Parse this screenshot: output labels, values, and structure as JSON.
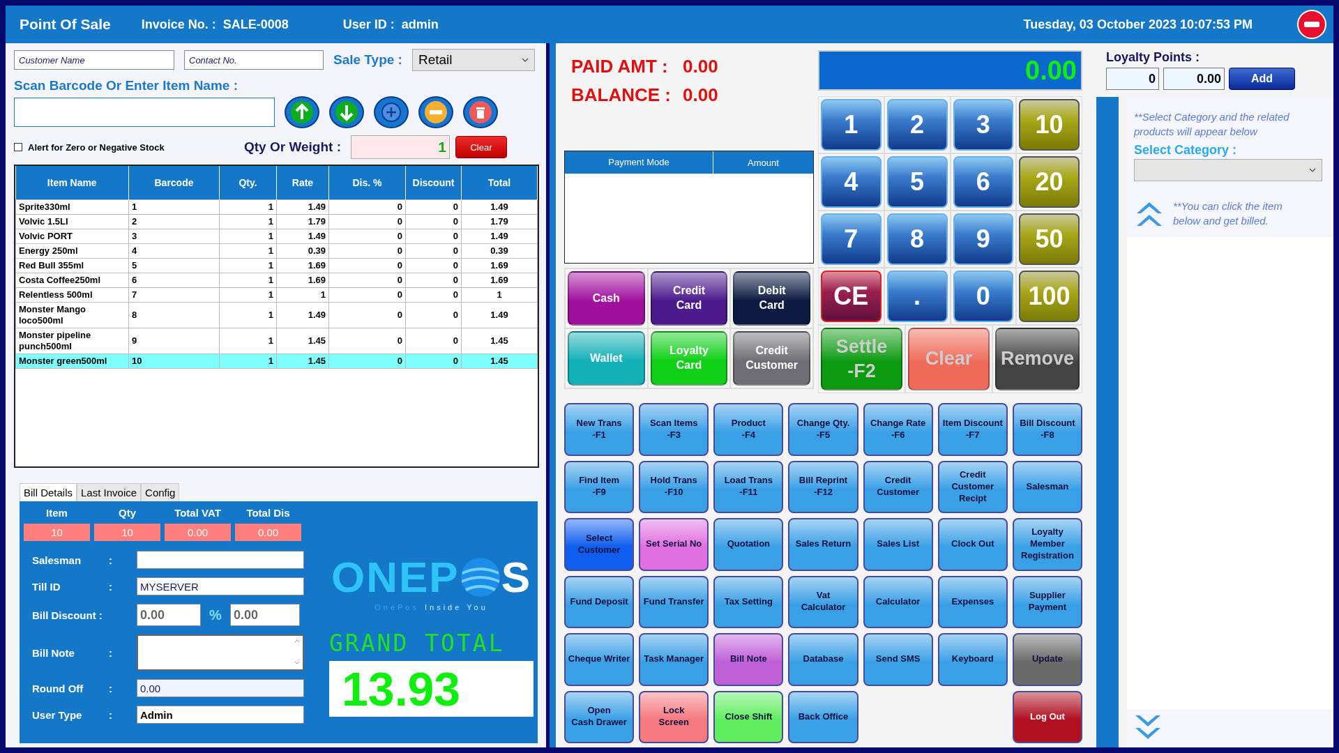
{
  "header": {
    "title": "Point Of Sale",
    "invoice_label": "Invoice No. :",
    "invoice_no": "SALE-0008",
    "user_label": "User ID :",
    "user_id": "admin",
    "datetime": "Tuesday, 03 October 2023 10:07:53 PM"
  },
  "customer": {
    "name_placeholder": "Customer Name",
    "contact_placeholder": "Contact No.",
    "sale_type_label": "Sale Type :",
    "sale_type": "Retail"
  },
  "scan": {
    "label": "Scan Barcode Or Enter Item Name :"
  },
  "stock_alert": {
    "label": "Alert for Zero or Negative Stock",
    "checked": false
  },
  "qty": {
    "label": "Qty Or Weight :",
    "value": "1",
    "clear": "Clear"
  },
  "table": {
    "columns": [
      "Item Name",
      "Barcode",
      "Qty.",
      "Rate",
      "Dis. %",
      "Discount",
      "Total"
    ],
    "rows": [
      {
        "cells": [
          "Sprite330ml",
          "1",
          "1",
          "1.49",
          "0",
          "0",
          "1.49"
        ],
        "selected": false
      },
      {
        "cells": [
          "Volvic 1.5LI",
          "2",
          "1",
          "1.79",
          "0",
          "0",
          "1.79"
        ],
        "selected": false
      },
      {
        "cells": [
          "Volvic PORT",
          "3",
          "1",
          "1.49",
          "0",
          "0",
          "1.49"
        ],
        "selected": false
      },
      {
        "cells": [
          "Energy 250ml",
          "4",
          "1",
          "0.39",
          "0",
          "0",
          "0.39"
        ],
        "selected": false
      },
      {
        "cells": [
          "Red Bull 355ml",
          "5",
          "1",
          "1.69",
          "0",
          "0",
          "1.69"
        ],
        "selected": false
      },
      {
        "cells": [
          "Costa Coffee250ml",
          "6",
          "1",
          "1.69",
          "0",
          "0",
          "1.69"
        ],
        "selected": false
      },
      {
        "cells": [
          "Relentless 500ml",
          "7",
          "1",
          "1",
          "0",
          "0",
          "1"
        ],
        "selected": false
      },
      {
        "cells": [
          "Monster Mango loco500ml",
          "8",
          "1",
          "1.49",
          "0",
          "0",
          "1.49"
        ],
        "selected": false
      },
      {
        "cells": [
          "Monster pipeline punch500ml",
          "9",
          "1",
          "1.45",
          "0",
          "0",
          "1.45"
        ],
        "selected": false
      },
      {
        "cells": [
          "Monster green500ml",
          "10",
          "1",
          "1.45",
          "0",
          "0",
          "1.45"
        ],
        "selected": true
      }
    ]
  },
  "tabs": [
    {
      "label": "Bill Details",
      "selected": true
    },
    {
      "label": "Last Invoice",
      "selected": false
    },
    {
      "label": "Config",
      "selected": false
    }
  ],
  "summary": [
    {
      "label": "Item",
      "value": "10"
    },
    {
      "label": "Qty",
      "value": "10"
    },
    {
      "label": "Total VAT",
      "value": "0.00"
    },
    {
      "label": "Total Dis",
      "value": "0.00"
    }
  ],
  "bill": {
    "salesman_label": "Salesman",
    "till_label": "Till ID",
    "till": "MYSERVER",
    "discount_label": "Bill Discount :",
    "discount": "0.00",
    "percent_sign": "%",
    "discount_pct": "0.00",
    "note_label": "Bill Note",
    "round_label": "Round Off",
    "round_off": "0.00",
    "user_type_label": "User Type",
    "user_type": "Admin",
    "colon": ":"
  },
  "logo": {
    "left": "ONEP",
    "right": "S",
    "tagline_brand": "OnePos",
    "tagline_rest": "Inside You"
  },
  "grand_total": {
    "label": "GRAND TOTAL",
    "value": "13.93"
  },
  "payment": {
    "paid_label": "PAID AMT :",
    "paid": "0.00",
    "balance_label": "BALANCE :",
    "balance": "0.00",
    "display": "0.00",
    "columns": [
      "Payment Mode",
      "Amount"
    ]
  },
  "keypad": [
    {
      "label": "1",
      "kind": "digit"
    },
    {
      "label": "2",
      "kind": "digit"
    },
    {
      "label": "3",
      "kind": "digit"
    },
    {
      "label": "10",
      "kind": "amount"
    },
    {
      "label": "4",
      "kind": "digit"
    },
    {
      "label": "5",
      "kind": "digit"
    },
    {
      "label": "6",
      "kind": "digit"
    },
    {
      "label": "20",
      "kind": "amount"
    },
    {
      "label": "7",
      "kind": "digit"
    },
    {
      "label": "8",
      "kind": "digit"
    },
    {
      "label": "9",
      "kind": "digit"
    },
    {
      "label": "50",
      "kind": "amount"
    },
    {
      "label": "CE",
      "kind": "cancel"
    },
    {
      "label": ".",
      "kind": "digit"
    },
    {
      "label": "0",
      "kind": "digit"
    },
    {
      "label": "100",
      "kind": "amount"
    }
  ],
  "payment_modes": [
    {
      "label": "Cash",
      "color": "#a0109e"
    },
    {
      "label": "Credit\nCard",
      "color": "#4b1a8c"
    },
    {
      "label": "Debit\nCard",
      "color": "#0a1a40"
    },
    {
      "label": "Wallet",
      "color": "#14b0b8"
    },
    {
      "label": "Loyalty\nCard",
      "color": "#10d018"
    },
    {
      "label": "Credit\nCustomer",
      "color": "#6e6e74"
    }
  ],
  "actions": [
    {
      "label": "Settle\n-F2",
      "color": "#0c9a10"
    },
    {
      "label": "Clear",
      "color": "#ef6a58"
    },
    {
      "label": "Remove",
      "color": "#444444"
    }
  ],
  "function_buttons": [
    {
      "label": "New Trans\n-F1",
      "color": "#3aa0e6"
    },
    {
      "label": "Scan Items\n-F3",
      "color": "#3aa0e6"
    },
    {
      "label": "Product\n-F4",
      "color": "#3aa0e6"
    },
    {
      "label": "Change Qty.\n-F5",
      "color": "#3aa0e6"
    },
    {
      "label": "Change Rate\n-F6",
      "color": "#3aa0e6"
    },
    {
      "label": "Item Discount\n-F7",
      "color": "#3aa0e6"
    },
    {
      "label": "Bill Discount\n-F8",
      "color": "#3aa0e6"
    },
    {
      "label": "Find Item\n-F9",
      "color": "#3aa0e6"
    },
    {
      "label": "Hold Trans\n-F10",
      "color": "#3aa0e6"
    },
    {
      "label": "Load Trans\n-F11",
      "color": "#3aa0e6"
    },
    {
      "label": "Bill Reprint\n-F12",
      "color": "#3aa0e6"
    },
    {
      "label": "Credit\nCustomer",
      "color": "#3aa0e6"
    },
    {
      "label": "Credit\nCustomer\nRecipt",
      "color": "#3aa0e6"
    },
    {
      "label": "Salesman",
      "color": "#3aa0e6"
    },
    {
      "label": "Select Customer",
      "color": "#0f5ef0"
    },
    {
      "label": "Set Serial No",
      "color": "#e070e0"
    },
    {
      "label": "Quotation",
      "color": "#3aa0e6"
    },
    {
      "label": "Sales Return",
      "color": "#3aa0e6"
    },
    {
      "label": "Sales List",
      "color": "#3aa0e6"
    },
    {
      "label": "Clock Out",
      "color": "#3aa0e6"
    },
    {
      "label": "Loyalty Member Registration",
      "color": "#3aa0e6"
    },
    {
      "label": "Fund Deposit",
      "color": "#3aa0e6"
    },
    {
      "label": "Fund Transfer",
      "color": "#3aa0e6"
    },
    {
      "label": "Tax Setting",
      "color": "#3aa0e6"
    },
    {
      "label": "Vat\nCalculator",
      "color": "#3aa0e6"
    },
    {
      "label": "Calculator",
      "color": "#3aa0e6"
    },
    {
      "label": "Expenses",
      "color": "#3aa0e6"
    },
    {
      "label": "Supplier Payment",
      "color": "#3aa0e6"
    },
    {
      "label": "Cheque Writer",
      "color": "#3aa0e6"
    },
    {
      "label": "Task Manager",
      "color": "#3aa0e6"
    },
    {
      "label": "Bill Note",
      "color": "#c060d8"
    },
    {
      "label": "Database",
      "color": "#3aa0e6"
    },
    {
      "label": "Send SMS",
      "color": "#3aa0e6"
    },
    {
      "label": "Keyboard",
      "color": "#3aa0e6"
    },
    {
      "label": "Update",
      "color": "#6a6a6a"
    },
    {
      "label": "Open\nCash Drawer",
      "color": "#3aa0e6"
    },
    {
      "label": "Lock\nScreen",
      "color": "#f47a80"
    },
    {
      "label": "Close Shift",
      "color": "#60ee60"
    },
    {
      "label": "Back Office",
      "color": "#3aa0e6"
    }
  ],
  "logout_button": {
    "label": "Log Out",
    "color": "#b01020"
  },
  "loyalty": {
    "label": "Loyalty Points :",
    "points": "0",
    "amount": "0.00",
    "add": "Add"
  },
  "category": {
    "hint": "**Select Category and  the related products  will appear below",
    "label": "Select Category :",
    "click_hint": "**You can click the item below and get billed."
  }
}
